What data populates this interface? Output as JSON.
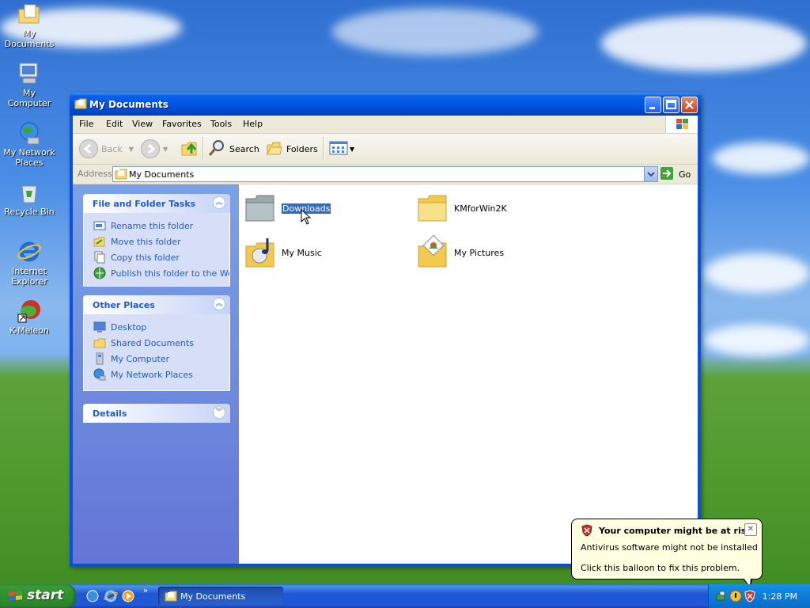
{
  "desktop": {
    "icons": [
      {
        "label": "My Documents"
      },
      {
        "label": "My Computer"
      },
      {
        "label": "My Network Places"
      },
      {
        "label": "Recycle Bin"
      },
      {
        "label": "Internet Explorer"
      },
      {
        "label": "K-Meleon"
      }
    ]
  },
  "window": {
    "title": "My Documents",
    "menu": [
      "File",
      "Edit",
      "View",
      "Favorites",
      "Tools",
      "Help"
    ],
    "toolbar": {
      "back_label": "Back",
      "search_label": "Search",
      "folders_label": "Folders"
    },
    "address": {
      "label": "Address",
      "value": "My Documents",
      "go_label": "Go"
    },
    "panels": {
      "tasks": {
        "title": "File and Folder Tasks",
        "items": [
          "Rename this folder",
          "Move this folder",
          "Copy this folder",
          "Publish this folder to the Web"
        ]
      },
      "places": {
        "title": "Other Places",
        "items": [
          "Desktop",
          "Shared Documents",
          "My Computer",
          "My Network Places"
        ]
      },
      "details": {
        "title": "Details"
      }
    },
    "files": [
      {
        "name": "Downloads",
        "selected": true
      },
      {
        "name": "KMforWin2K",
        "selected": false
      },
      {
        "name": "My Music",
        "selected": false
      },
      {
        "name": "My Pictures",
        "selected": false
      }
    ]
  },
  "taskbar": {
    "start_label": "start",
    "task_label": "My Documents",
    "clock": "1:28 PM"
  },
  "balloon": {
    "title": "Your computer might be at risk",
    "line1": "Antivirus software might not be installed",
    "line2": "Click this balloon to fix this problem.",
    "close": "✕"
  },
  "colors": {
    "titlebar_blue": "#0055e5",
    "task_link": "#215dc6",
    "selection": "#316ac5",
    "start_green": "#2f8f2f",
    "balloon_bg": "#ffffe1"
  }
}
